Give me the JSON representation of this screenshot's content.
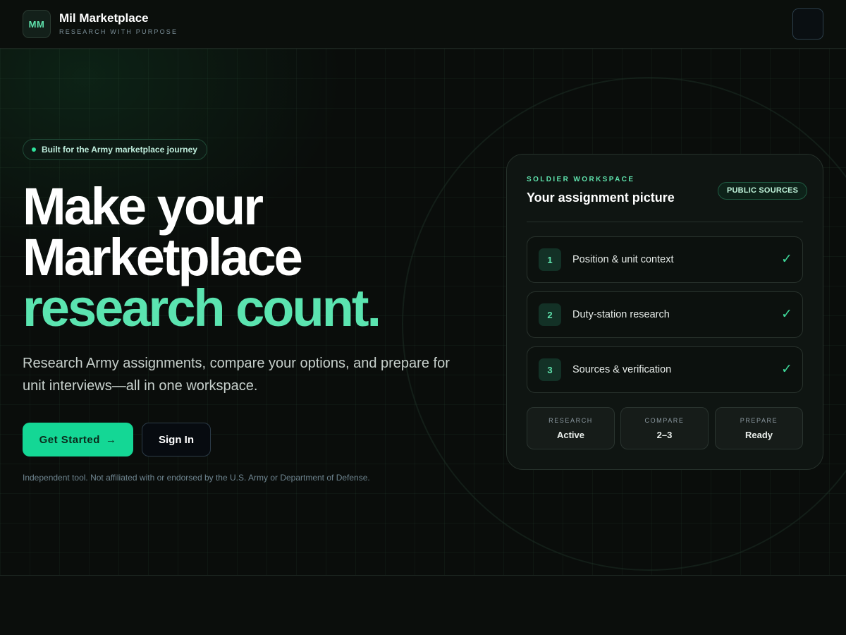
{
  "header": {
    "logo_initials": "MM",
    "brand_name": "Mil Marketplace",
    "brand_tagline": "RESEARCH WITH PURPOSE"
  },
  "hero": {
    "badge": "Built for the Army marketplace journey",
    "headline_line1": "Make your",
    "headline_line2": "Marketplace",
    "headline_line3": "research count.",
    "subtitle": "Research Army assignments, compare your options, and prepare for unit interviews—all in one workspace.",
    "primary_cta": "Get Started",
    "primary_cta_arrow": "→",
    "secondary_cta": "Sign In",
    "disclaimer": "Independent tool. Not affiliated with or endorsed by the U.S. Army or Department of Defense."
  },
  "workspace": {
    "kicker": "SOLDIER WORKSPACE",
    "title": "Your assignment picture",
    "pill": "PUBLIC SOURCES",
    "steps": [
      {
        "number": "1",
        "label": "Position & unit context",
        "check": "✓"
      },
      {
        "number": "2",
        "label": "Duty-station research",
        "check": "✓"
      },
      {
        "number": "3",
        "label": "Sources & verification",
        "check": "✓"
      }
    ],
    "stats": [
      {
        "label": "RESEARCH",
        "value": "Active"
      },
      {
        "label": "COMPARE",
        "value": "2–3"
      },
      {
        "label": "PREPARE",
        "value": "Ready"
      }
    ]
  },
  "colors": {
    "accent": "#5be4b0",
    "primary_button": "#14d795",
    "background": "#0a0d0b"
  }
}
